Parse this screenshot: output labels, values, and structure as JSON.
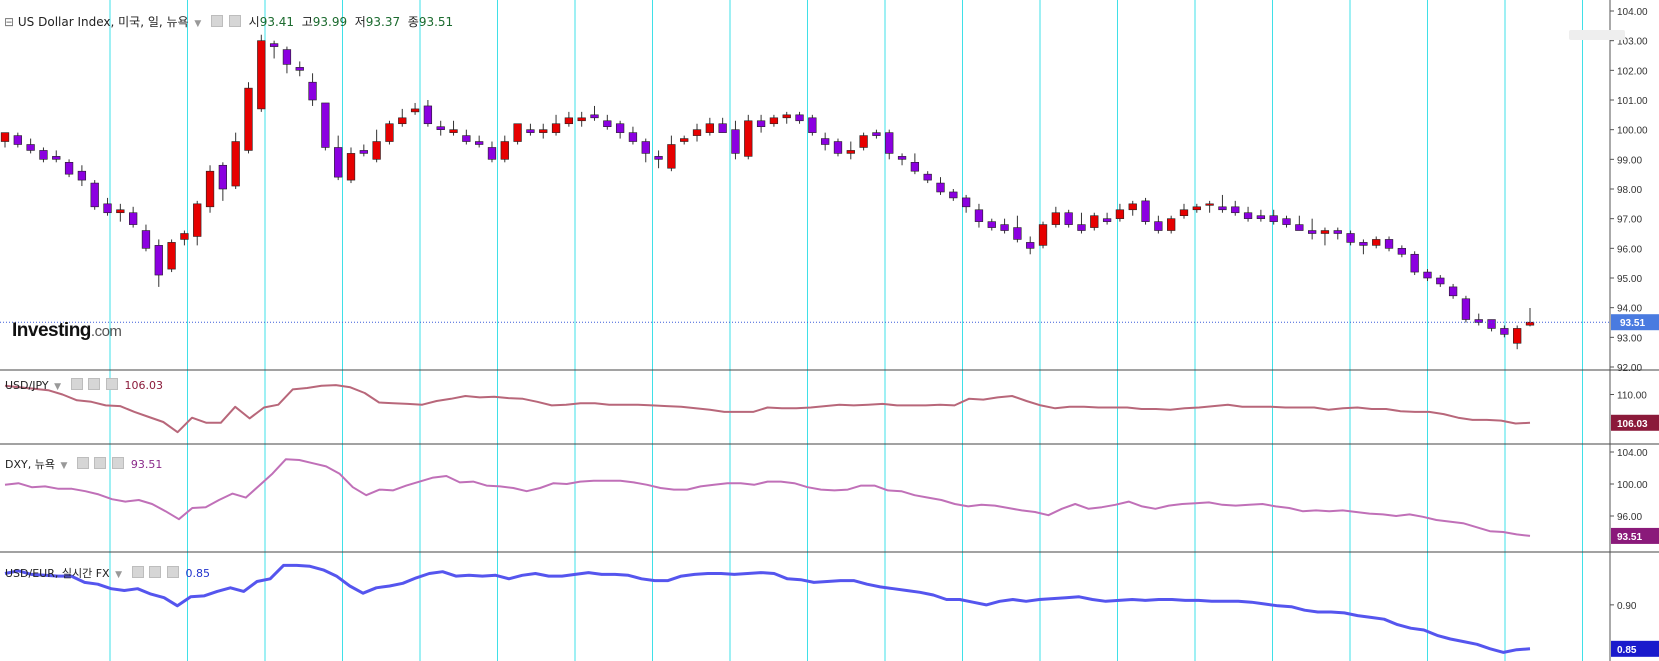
{
  "header": {
    "symbol": "US Dollar Index, 미국, 일, 뉴욕",
    "open_label": "시",
    "open": "93.41",
    "high_label": "고",
    "high": "93.99",
    "low_label": "저",
    "low": "93.37",
    "close_label": "종",
    "close": "93.51"
  },
  "brand": {
    "name": "Investing",
    "suffix": ".com"
  },
  "colors": {
    "up": "#e60000",
    "down": "#8b00e0",
    "grid": "#3fe0e8",
    "usdjpy": "#b8677a",
    "dxy": "#c070b8",
    "usdeur": "#5555ee"
  },
  "chart_data": [
    {
      "type": "candlestick",
      "title": "US Dollar Index, 미국, 일, 뉴욕",
      "ylim": [
        92,
        104
      ],
      "yticks": [
        "104.00",
        "103.00",
        "102.00",
        "101.00",
        "100.00",
        "99.00",
        "98.00",
        "97.00",
        "96.00",
        "95.00",
        "94.00",
        "93.00",
        "92.00"
      ],
      "last_value": "93.51",
      "ohlc": [
        [
          99.6,
          99.9,
          99.4,
          99.9
        ],
        [
          99.8,
          99.9,
          99.4,
          99.5
        ],
        [
          99.5,
          99.7,
          99.2,
          99.3
        ],
        [
          99.3,
          99.4,
          98.9,
          99.0
        ],
        [
          99.1,
          99.3,
          98.9,
          99.0
        ],
        [
          98.9,
          99.0,
          98.4,
          98.5
        ],
        [
          98.6,
          98.8,
          98.1,
          98.3
        ],
        [
          98.2,
          98.3,
          97.3,
          97.4
        ],
        [
          97.5,
          97.7,
          97.1,
          97.2
        ],
        [
          97.2,
          97.5,
          96.9,
          97.3
        ],
        [
          97.2,
          97.4,
          96.7,
          96.8
        ],
        [
          96.6,
          96.8,
          95.9,
          96.0
        ],
        [
          96.1,
          96.3,
          94.7,
          95.1
        ],
        [
          95.3,
          96.3,
          95.2,
          96.2
        ],
        [
          96.3,
          96.6,
          96.1,
          96.5
        ],
        [
          96.4,
          97.6,
          96.1,
          97.5
        ],
        [
          97.4,
          98.8,
          97.2,
          98.6
        ],
        [
          98.8,
          98.9,
          97.6,
          98.0
        ],
        [
          98.1,
          99.9,
          98.0,
          99.6
        ],
        [
          99.3,
          101.6,
          99.2,
          101.4
        ],
        [
          100.7,
          103.2,
          100.6,
          103.0
        ],
        [
          102.9,
          103.0,
          102.4,
          102.8
        ],
        [
          102.7,
          102.8,
          101.9,
          102.2
        ],
        [
          102.1,
          102.3,
          101.8,
          102.0
        ],
        [
          101.6,
          101.9,
          100.8,
          101.0
        ],
        [
          100.9,
          100.9,
          99.3,
          99.4
        ],
        [
          99.4,
          99.8,
          98.3,
          98.4
        ],
        [
          98.3,
          99.4,
          98.2,
          99.2
        ],
        [
          99.3,
          99.5,
          99.1,
          99.2
        ],
        [
          99.0,
          100.0,
          98.9,
          99.6
        ],
        [
          99.6,
          100.3,
          99.5,
          100.2
        ],
        [
          100.2,
          100.7,
          100.1,
          100.4
        ],
        [
          100.6,
          100.9,
          100.5,
          100.7
        ],
        [
          100.8,
          101.0,
          100.1,
          100.2
        ],
        [
          100.1,
          100.3,
          99.8,
          100.0
        ],
        [
          99.9,
          100.3,
          99.8,
          100.0
        ],
        [
          99.8,
          100.0,
          99.5,
          99.6
        ],
        [
          99.6,
          99.8,
          99.4,
          99.5
        ],
        [
          99.4,
          99.6,
          98.9,
          99.0
        ],
        [
          99.0,
          99.8,
          98.9,
          99.6
        ],
        [
          99.6,
          100.2,
          99.5,
          100.2
        ],
        [
          100.0,
          100.2,
          99.8,
          99.9
        ],
        [
          99.9,
          100.2,
          99.7,
          100.0
        ],
        [
          99.9,
          100.5,
          99.8,
          100.2
        ],
        [
          100.2,
          100.6,
          100.1,
          100.4
        ],
        [
          100.3,
          100.6,
          100.1,
          100.4
        ],
        [
          100.5,
          100.8,
          100.3,
          100.4
        ],
        [
          100.3,
          100.5,
          100.0,
          100.1
        ],
        [
          100.2,
          100.3,
          99.7,
          99.9
        ],
        [
          99.9,
          100.1,
          99.5,
          99.6
        ],
        [
          99.6,
          99.7,
          98.9,
          99.2
        ],
        [
          99.1,
          99.3,
          98.7,
          99.0
        ],
        [
          98.7,
          99.8,
          98.6,
          99.5
        ],
        [
          99.6,
          99.8,
          99.5,
          99.7
        ],
        [
          99.8,
          100.2,
          99.6,
          100.0
        ],
        [
          99.9,
          100.4,
          99.8,
          100.2
        ],
        [
          100.2,
          100.4,
          99.9,
          99.9
        ],
        [
          100.0,
          100.3,
          99.0,
          99.2
        ],
        [
          99.1,
          100.5,
          99.0,
          100.3
        ],
        [
          100.3,
          100.5,
          99.9,
          100.1
        ],
        [
          100.2,
          100.5,
          100.1,
          100.4
        ],
        [
          100.4,
          100.6,
          100.2,
          100.5
        ],
        [
          100.5,
          100.6,
          100.2,
          100.3
        ],
        [
          100.4,
          100.5,
          99.8,
          99.9
        ],
        [
          99.7,
          99.9,
          99.3,
          99.5
        ],
        [
          99.6,
          99.7,
          99.1,
          99.2
        ],
        [
          99.2,
          99.6,
          99.0,
          99.3
        ],
        [
          99.4,
          99.9,
          99.3,
          99.8
        ],
        [
          99.9,
          100.0,
          99.7,
          99.8
        ],
        [
          99.9,
          100.0,
          99.0,
          99.2
        ],
        [
          99.1,
          99.2,
          98.8,
          99.0
        ],
        [
          98.9,
          99.2,
          98.5,
          98.6
        ],
        [
          98.5,
          98.6,
          98.2,
          98.3
        ],
        [
          98.2,
          98.4,
          97.8,
          97.9
        ],
        [
          97.9,
          98.0,
          97.6,
          97.7
        ],
        [
          97.7,
          97.8,
          97.2,
          97.4
        ],
        [
          97.3,
          97.5,
          96.7,
          96.9
        ],
        [
          96.9,
          97.0,
          96.6,
          96.7
        ],
        [
          96.8,
          97.0,
          96.5,
          96.6
        ],
        [
          96.7,
          97.1,
          96.2,
          96.3
        ],
        [
          96.2,
          96.4,
          95.8,
          96.0
        ],
        [
          96.1,
          96.9,
          96.0,
          96.8
        ],
        [
          96.8,
          97.4,
          96.7,
          97.2
        ],
        [
          97.2,
          97.3,
          96.7,
          96.8
        ],
        [
          96.8,
          97.2,
          96.5,
          96.6
        ],
        [
          96.7,
          97.2,
          96.6,
          97.1
        ],
        [
          97.0,
          97.2,
          96.8,
          96.9
        ],
        [
          97.0,
          97.5,
          96.9,
          97.3
        ],
        [
          97.3,
          97.6,
          97.1,
          97.5
        ],
        [
          97.6,
          97.7,
          96.8,
          96.9
        ],
        [
          96.9,
          97.1,
          96.5,
          96.6
        ],
        [
          96.6,
          97.1,
          96.5,
          97.0
        ],
        [
          97.1,
          97.5,
          97.0,
          97.3
        ],
        [
          97.3,
          97.5,
          97.2,
          97.4
        ],
        [
          97.5,
          97.6,
          97.2,
          97.5
        ],
        [
          97.4,
          97.8,
          97.2,
          97.3
        ],
        [
          97.4,
          97.6,
          97.1,
          97.2
        ],
        [
          97.2,
          97.4,
          96.9,
          97.0
        ],
        [
          97.1,
          97.3,
          96.9,
          97.0
        ],
        [
          97.1,
          97.3,
          96.8,
          96.9
        ],
        [
          97.0,
          97.1,
          96.7,
          96.8
        ],
        [
          96.8,
          97.1,
          96.6,
          96.6
        ],
        [
          96.6,
          97.0,
          96.3,
          96.5
        ],
        [
          96.5,
          96.7,
          96.1,
          96.6
        ],
        [
          96.6,
          96.7,
          96.3,
          96.5
        ],
        [
          96.5,
          96.6,
          96.1,
          96.2
        ],
        [
          96.2,
          96.3,
          95.8,
          96.1
        ],
        [
          96.1,
          96.4,
          96.0,
          96.3
        ],
        [
          96.3,
          96.4,
          95.9,
          96.0
        ],
        [
          96.0,
          96.1,
          95.7,
          95.8
        ],
        [
          95.8,
          95.9,
          95.1,
          95.2
        ],
        [
          95.2,
          95.3,
          94.9,
          95.0
        ],
        [
          95.0,
          95.1,
          94.7,
          94.8
        ],
        [
          94.7,
          94.8,
          94.3,
          94.4
        ],
        [
          94.3,
          94.4,
          93.5,
          93.6
        ],
        [
          93.6,
          93.8,
          93.4,
          93.5
        ],
        [
          93.6,
          93.6,
          93.2,
          93.3
        ],
        [
          93.3,
          93.4,
          93.0,
          93.1
        ],
        [
          92.8,
          93.4,
          92.6,
          93.3
        ],
        [
          93.41,
          93.99,
          93.37,
          93.51
        ]
      ]
    },
    {
      "type": "line",
      "title": "USD/JPY",
      "last_value": "106.03",
      "yticks": [
        "110.00"
      ],
      "ylim": [
        104,
        112
      ],
      "values": [
        111.2,
        111.0,
        110.8,
        110.6,
        110.0,
        109.2,
        109.0,
        108.5,
        108.4,
        107.6,
        106.9,
        106.2,
        104.8,
        106.8,
        106.1,
        106.1,
        108.3,
        106.7,
        108.2,
        108.6,
        110.7,
        110.9,
        111.2,
        111.3,
        111.0,
        110.2,
        108.9,
        108.8,
        108.7,
        108.6,
        109.1,
        109.4,
        109.8,
        109.6,
        109.7,
        109.5,
        109.4,
        109.0,
        108.5,
        108.6,
        108.8,
        108.8,
        108.6,
        108.6,
        108.6,
        108.5,
        108.4,
        108.3,
        108.1,
        107.9,
        107.6,
        107.6,
        107.6,
        108.2,
        108.1,
        108.1,
        108.2,
        108.4,
        108.6,
        108.5,
        108.6,
        108.7,
        108.5,
        108.5,
        108.5,
        108.6,
        108.5,
        109.4,
        109.3,
        109.6,
        109.8,
        109.1,
        108.5,
        108.1,
        108.3,
        108.3,
        108.2,
        108.2,
        108.2,
        108.0,
        108.0,
        107.9,
        108.1,
        108.2,
        108.4,
        108.6,
        108.3,
        108.3,
        108.3,
        108.2,
        108.2,
        108.2,
        107.9,
        108.1,
        108.2,
        108.0,
        108.0,
        107.7,
        107.6,
        107.6,
        107.3,
        106.8,
        106.5,
        106.5,
        106.4,
        106.0,
        106.1
      ]
    },
    {
      "type": "line",
      "title": "DXY, 뉴욕",
      "last_value": "93.51",
      "yticks": [
        "104.00",
        "100.00",
        "96.00"
      ],
      "ylim": [
        92,
        104
      ],
      "values": [
        99.9,
        100.1,
        99.6,
        99.7,
        99.4,
        99.4,
        99.1,
        98.7,
        98.1,
        97.8,
        98.0,
        97.5,
        96.6,
        95.6,
        97.0,
        97.1,
        98.0,
        98.8,
        98.3,
        99.8,
        101.3,
        103.1,
        103.0,
        102.6,
        102.2,
        101.3,
        99.6,
        98.6,
        99.3,
        99.2,
        99.8,
        100.3,
        100.8,
        101.0,
        100.2,
        100.3,
        99.8,
        99.7,
        99.5,
        99.1,
        99.5,
        100.1,
        100.0,
        100.3,
        100.4,
        100.4,
        100.4,
        100.2,
        99.9,
        99.5,
        99.3,
        99.3,
        99.7,
        99.9,
        100.1,
        100.1,
        99.9,
        100.3,
        100.3,
        100.1,
        99.6,
        99.3,
        99.2,
        99.3,
        99.8,
        99.8,
        99.2,
        99.1,
        98.6,
        98.3,
        98.0,
        97.5,
        97.2,
        97.4,
        97.3,
        97.0,
        96.7,
        96.5,
        96.1,
        96.9,
        97.5,
        96.9,
        97.1,
        97.4,
        97.8,
        97.2,
        96.9,
        97.3,
        97.5,
        97.6,
        97.7,
        97.4,
        97.3,
        97.4,
        97.5,
        97.2,
        97.0,
        96.6,
        96.7,
        96.6,
        96.7,
        96.5,
        96.3,
        96.2,
        96.0,
        96.2,
        95.9,
        95.5,
        95.3,
        95.1,
        94.6,
        94.1,
        94.0,
        93.7,
        93.51
      ]
    },
    {
      "type": "line",
      "title": "USD/EUR, 실시간 FX",
      "last_value": "0.85",
      "yticks": [
        "0.90"
      ],
      "ylim": [
        0.843,
        0.95
      ],
      "values": [
        0.935,
        0.938,
        0.934,
        0.933,
        0.932,
        0.932,
        0.925,
        0.923,
        0.918,
        0.916,
        0.918,
        0.912,
        0.908,
        0.899,
        0.909,
        0.91,
        0.915,
        0.919,
        0.915,
        0.926,
        0.929,
        0.944,
        0.944,
        0.943,
        0.939,
        0.932,
        0.921,
        0.913,
        0.919,
        0.921,
        0.924,
        0.93,
        0.935,
        0.937,
        0.932,
        0.933,
        0.932,
        0.933,
        0.929,
        0.933,
        0.935,
        0.932,
        0.932,
        0.934,
        0.936,
        0.934,
        0.934,
        0.933,
        0.929,
        0.927,
        0.927,
        0.932,
        0.934,
        0.935,
        0.935,
        0.934,
        0.935,
        0.936,
        0.935,
        0.929,
        0.928,
        0.925,
        0.926,
        0.927,
        0.927,
        0.923,
        0.92,
        0.918,
        0.916,
        0.914,
        0.911,
        0.906,
        0.906,
        0.903,
        0.9,
        0.904,
        0.906,
        0.904,
        0.906,
        0.907,
        0.908,
        0.909,
        0.906,
        0.904,
        0.905,
        0.906,
        0.905,
        0.906,
        0.906,
        0.905,
        0.905,
        0.904,
        0.904,
        0.904,
        0.903,
        0.901,
        0.899,
        0.898,
        0.894,
        0.892,
        0.892,
        0.891,
        0.888,
        0.886,
        0.884,
        0.878,
        0.874,
        0.872,
        0.866,
        0.862,
        0.859,
        0.856,
        0.851,
        0.847,
        0.85,
        0.851
      ]
    }
  ]
}
